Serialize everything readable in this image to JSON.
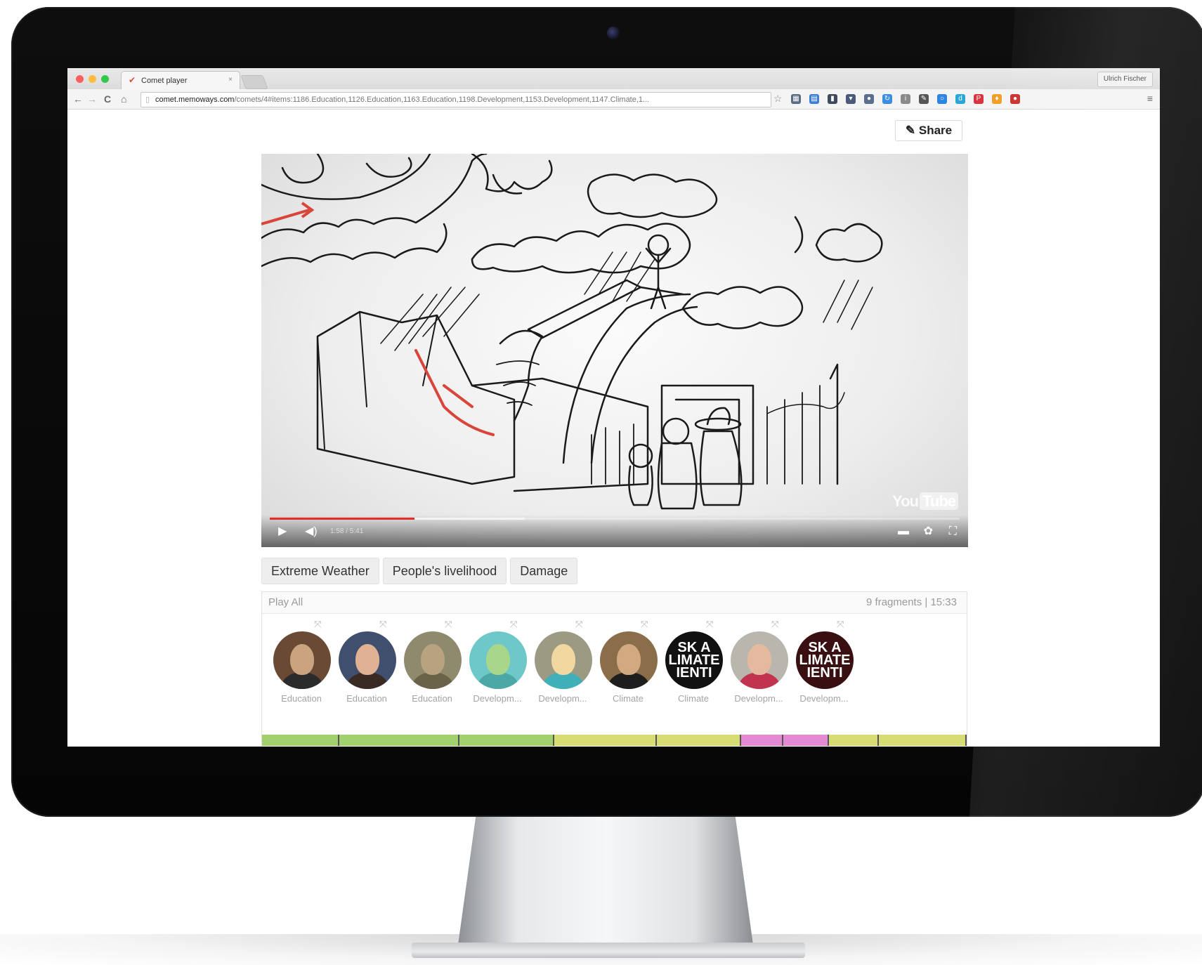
{
  "browser": {
    "tab_title": "Comet player",
    "tab_close": "×",
    "profile_name": "Ulrich Fischer",
    "url_domain": "comet.memoways.com",
    "url_path": "/comets/4#items:1186.Education,1126.Education,1163.Education,1198.Development,1153.Development,1147.Climate,1...",
    "nav": {
      "back": "←",
      "forward": "→",
      "reload": "C",
      "home": "⌂"
    }
  },
  "page": {
    "share_label": "Share",
    "video": {
      "time_text": "1:58 / 5:41",
      "progress_fraction": 0.21,
      "buffer_fraction": 0.37,
      "logo_you": "You",
      "logo_tube": "Tube"
    },
    "tags": [
      "Extreme Weather",
      "People's livelihood",
      "Damage"
    ],
    "playlist": {
      "play_all": "Play All",
      "meta": "9 fragments | 15:33",
      "items": [
        {
          "caption": "Education",
          "type": "person",
          "bg": "#6a4a35",
          "skin": "#caa37f",
          "cloth": "#2b2b2b"
        },
        {
          "caption": "Education",
          "type": "person",
          "bg": "#3f4f6d",
          "skin": "#e0b293",
          "cloth": "#3a2a24"
        },
        {
          "caption": "Education",
          "type": "person",
          "bg": "#8f8a6e",
          "skin": "#b8a27f",
          "cloth": "#6b6349"
        },
        {
          "caption": "Developm...",
          "type": "scene",
          "bg": "#6ec7c8",
          "skin": "#a8d68a",
          "cloth": "#4ca8a6"
        },
        {
          "caption": "Developm...",
          "type": "scene",
          "bg": "#9d9a84",
          "skin": "#f1d8a0",
          "cloth": "#3fb0b8"
        },
        {
          "caption": "Climate",
          "type": "person",
          "bg": "#8a6e4a",
          "skin": "#d3a982",
          "cloth": "#1e1e1e"
        },
        {
          "caption": "Climate",
          "type": "ask",
          "bg": "#111111",
          "text": "SK A\nLIMATE\nIENTI"
        },
        {
          "caption": "Developm...",
          "type": "person",
          "bg": "#b9b6ae",
          "skin": "#e5b9a0",
          "cloth": "#c23350"
        },
        {
          "caption": "Developm...",
          "type": "ask",
          "bg": "#3a0f12",
          "text": "SK A\nLIMATE\nIENTI"
        }
      ],
      "timeline_segments": [
        {
          "fraction": 0.11,
          "color": "#a3d06f"
        },
        {
          "fraction": 0.17,
          "color": "#a3d06f"
        },
        {
          "fraction": 0.135,
          "color": "#a3d06f"
        },
        {
          "fraction": 0.145,
          "color": "#d8dd73"
        },
        {
          "fraction": 0.12,
          "color": "#d8dd73"
        },
        {
          "fraction": 0.06,
          "color": "#e48ad3"
        },
        {
          "fraction": 0.065,
          "color": "#e48ad3"
        },
        {
          "fraction": 0.07,
          "color": "#d8dd73"
        },
        {
          "fraction": 0.125,
          "color": "#d8dd73"
        }
      ]
    }
  },
  "icons": {
    "share": "share-edit-icon",
    "play": "play-icon",
    "volume": "volume-icon",
    "captions": "captions-icon",
    "settings": "gear-icon",
    "fullscreen": "fullscreen-icon",
    "expand": "expand-icon"
  }
}
